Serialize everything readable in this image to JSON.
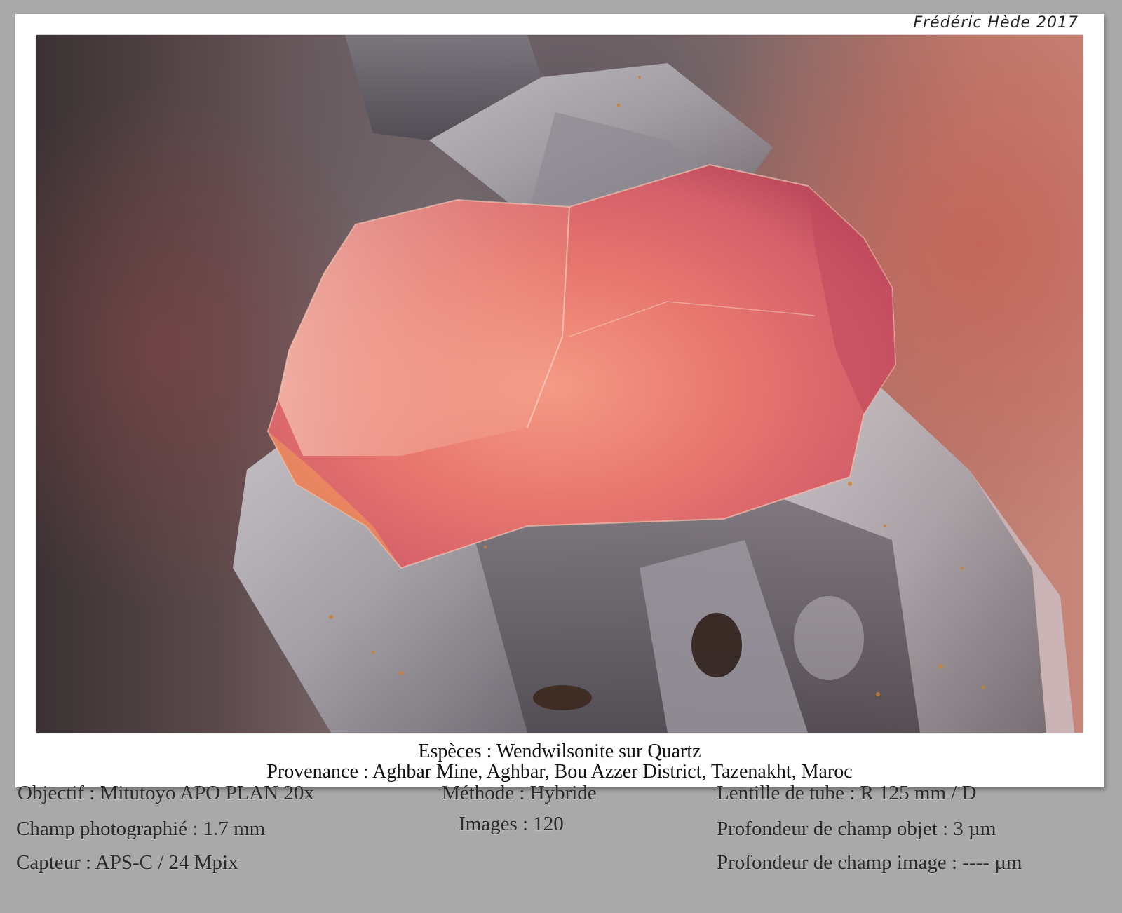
{
  "credit": "Frédéric Hède 2017",
  "caption": {
    "species": "Espèces : Wendwilsonite sur Quartz",
    "origin": "Provenance : Aghbar Mine, Aghbar, Bou Azzer District, Tazenakht, Maroc"
  },
  "specs": {
    "objective": "Objectif : Mitutoyo APO PLAN 20x",
    "field": "Champ photographié : 1.7 mm",
    "sensor": "Capteur : APS-C / 24 Mpix",
    "method": "Méthode : Hybride",
    "images": "Images : 120",
    "tube_lens": "Lentille de tube : R 125 mm / D",
    "object_dof": "Profondeur de champ objet : 3 µm",
    "image_dof": "Profondeur de champ image : ---- µm"
  },
  "colors": {
    "page_background": "#a9a9a9",
    "card": "#ffffff",
    "crystal": "#e8776e",
    "quartz": "#b9b8bd"
  }
}
